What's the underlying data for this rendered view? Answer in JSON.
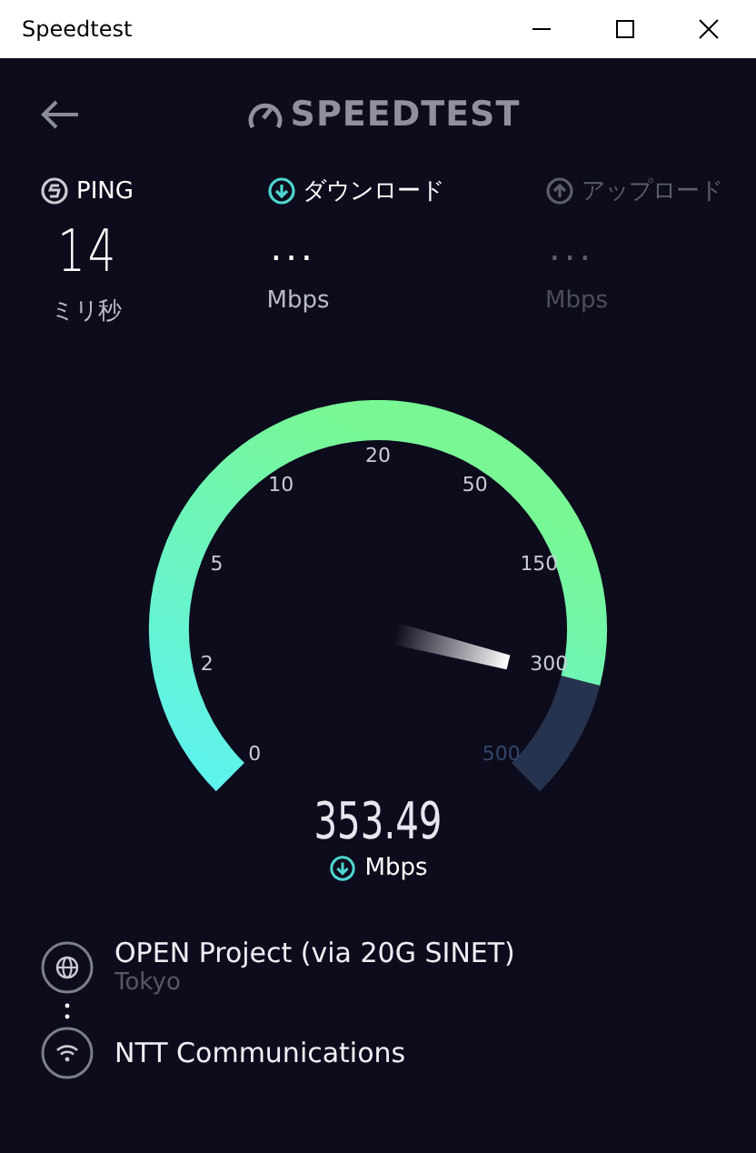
{
  "window": {
    "title": "Speedtest"
  },
  "header": {
    "logo": "SPEEDTEST"
  },
  "metrics": [
    {
      "kind": "ping",
      "label": "PING",
      "value": "14",
      "unit": "ミリ秒",
      "dimmed": false
    },
    {
      "kind": "download",
      "label": "ダウンロード",
      "value": "...",
      "unit": "Mbps",
      "dimmed": false
    },
    {
      "kind": "upload",
      "label": "アップロード",
      "value": "...",
      "unit": "Mbps",
      "dimmed": true
    }
  ],
  "gauge": {
    "ticks": [
      "0",
      "2",
      "5",
      "10",
      "20",
      "50",
      "150",
      "300",
      "500"
    ],
    "reading": "353.49",
    "unit": "Mbps"
  },
  "connections": [
    {
      "kind": "server",
      "name": "OPEN Project (via 20G SINET)",
      "location": "Tokyo"
    },
    {
      "kind": "isp",
      "name": "NTT Communications"
    }
  ]
}
